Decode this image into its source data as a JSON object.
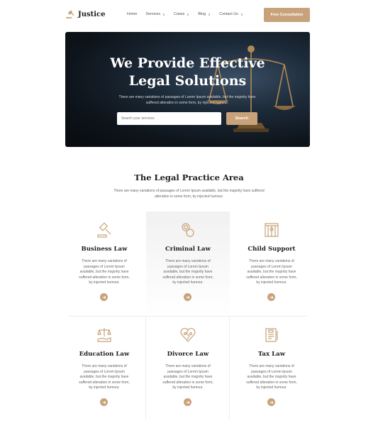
{
  "brand": {
    "name": "Justice",
    "accent": "#c8a27a"
  },
  "nav": {
    "items": [
      {
        "label": "Home",
        "has_dropdown": false
      },
      {
        "label": "Services",
        "has_dropdown": true
      },
      {
        "label": "Cases",
        "has_dropdown": true
      },
      {
        "label": "Blog",
        "has_dropdown": true
      },
      {
        "label": "Contact Us",
        "has_dropdown": true
      }
    ],
    "cta_label": "Free Consultation"
  },
  "hero": {
    "title_line1": "We Provide Effective",
    "title_line2": "Legal Solutions",
    "subtitle": "There are many variations of passages of Lorem Ipsum available, but the majority have suffered alteration in some form, by injected humour.",
    "search_placeholder": "Search your services",
    "search_button": "Search"
  },
  "practice": {
    "title": "The Legal Practice Area",
    "subtitle": "There are many variations of passages of Lorem Ipsum available, but the majority have suffered alteration in some form, by injected humour.",
    "cards": [
      {
        "title": "Business Law",
        "icon": "gavel-icon",
        "text": "There are many variations of passages of Lorem Ipsum available, but the majority have suffered alteration in some form, by injected humour."
      },
      {
        "title": "Criminal Law",
        "icon": "handcuffs-icon",
        "text": "There are many variations of passages of Lorem Ipsum available, but the majority have suffered alteration in some form, by injected humour."
      },
      {
        "title": "Child Support",
        "icon": "jail-icon",
        "text": "There are many variations of passages of Lorem Ipsum available, but the majority have suffered alteration in some form, by injected humour."
      },
      {
        "title": "Education Law",
        "icon": "scales-hand-icon",
        "text": "There are many variations of passages of Lorem Ipsum available, but the majority have suffered alteration in some form, by injected humour."
      },
      {
        "title": "Divorce Law",
        "icon": "broken-heart-icon",
        "text": "There are many variations of passages of Lorem Ipsum available, but the majority have suffered alteration in some form, by injected humour."
      },
      {
        "title": "Tax Law",
        "icon": "tax-document-icon",
        "text": "There are many variations of passages of Lorem Ipsum available, but the majority have suffered alteration in some form, by injected humour."
      }
    ]
  }
}
